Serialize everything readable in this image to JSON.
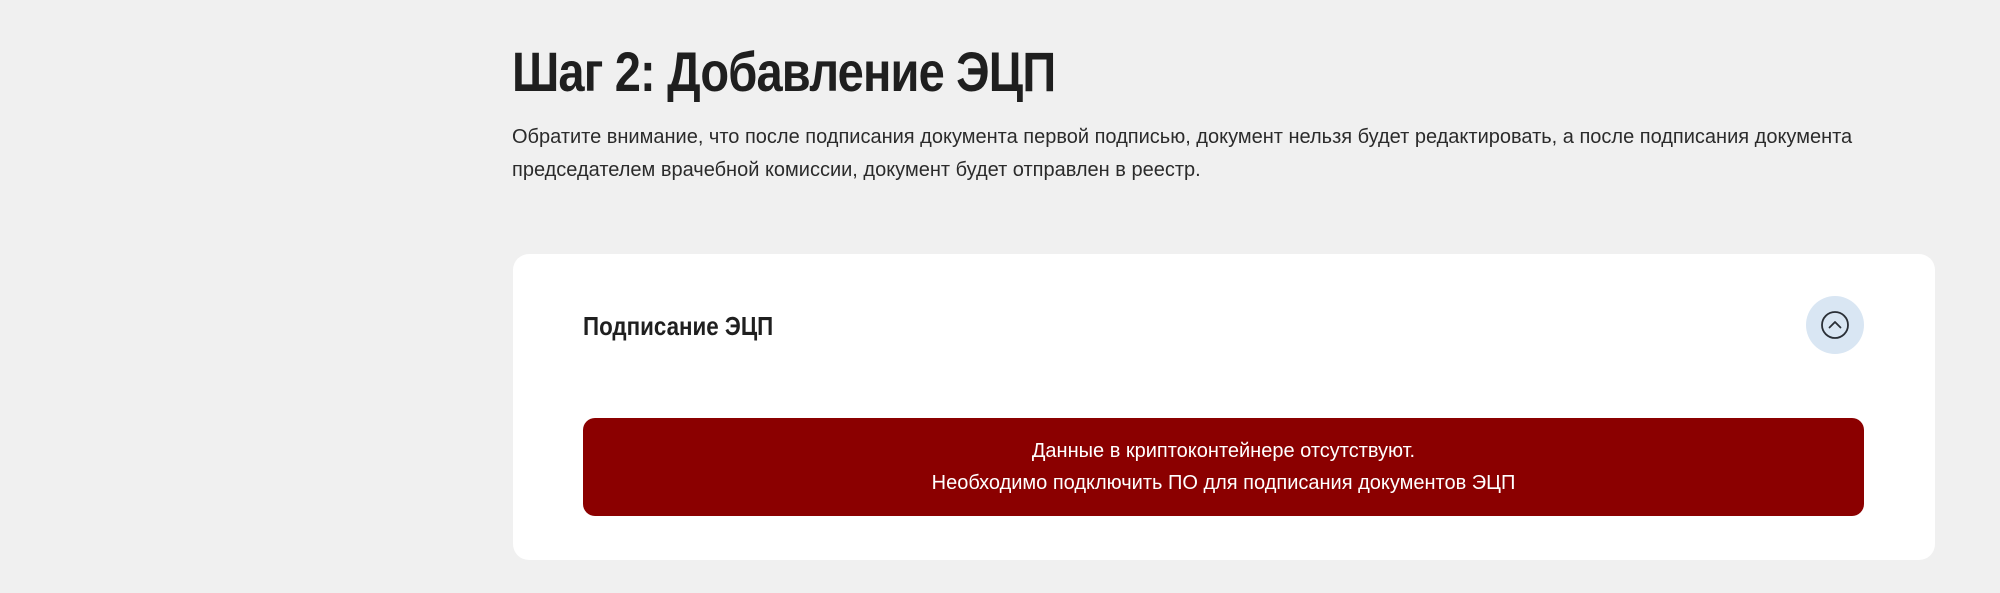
{
  "header": {
    "title": "Шаг 2: Добавление ЭЦП",
    "description": "Обратите внимание, что после подписания документа первой подписью, документ нельзя будет редактировать, а после подписания документа председателем врачебной комиссии, документ будет отправлен в реестр."
  },
  "signature_card": {
    "title": "Подписание ЭЦП",
    "collapse_icon": "chevron-up-icon",
    "alert": {
      "line1": "Данные в криптоконтейнере отсутствуют.",
      "line2": "Необходимо подключить ПО для подписания документов ЭЦП"
    }
  },
  "colors": {
    "page_background": "#f0f0f0",
    "card_background": "#ffffff",
    "alert_background": "#8b0000",
    "collapse_button_background": "#d9e6f3"
  }
}
